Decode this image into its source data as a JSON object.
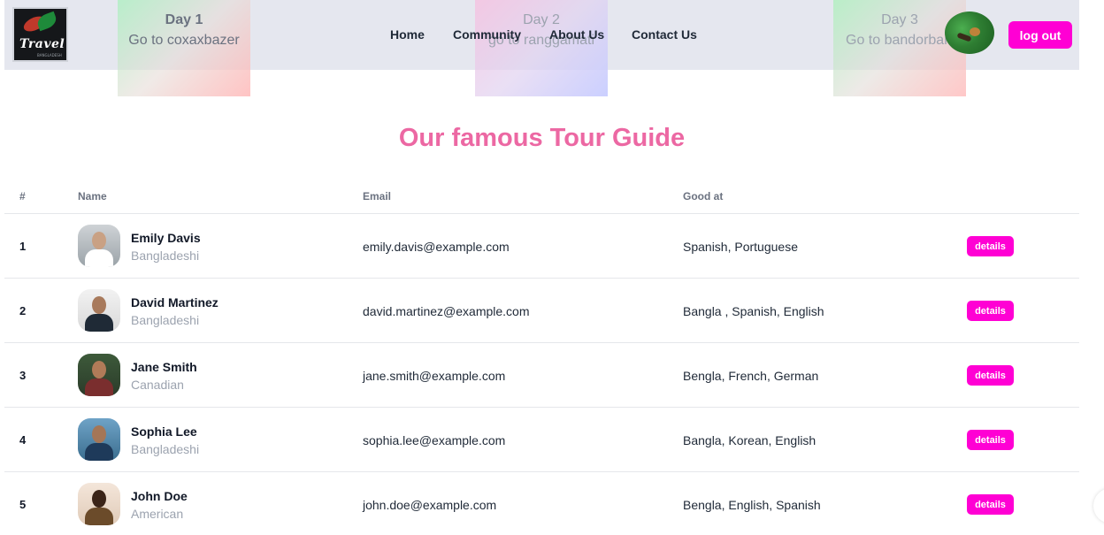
{
  "brand": {
    "logo_text": "Travel",
    "logo_subtext": "BANGLADESH"
  },
  "nav": {
    "links": [
      "Home",
      "Community",
      "About Us",
      "Contact Us"
    ],
    "logout_label": "log out"
  },
  "days": [
    {
      "title": "Day 1",
      "subtitle": "Go to coxaxbazer"
    },
    {
      "title": "Day 2",
      "subtitle": "go to ranggamati"
    },
    {
      "title": "Day 3",
      "subtitle": "Go to bandorban"
    }
  ],
  "section": {
    "title": "Our famous Tour Guide"
  },
  "table": {
    "headers": [
      "#",
      "Name",
      "Email",
      "Good at"
    ],
    "rows": [
      {
        "num": "1",
        "name": "Emily Davis",
        "nationality": "Bangladeshi",
        "email": "emily.davis@example.com",
        "skills": "Spanish, Portuguese",
        "action": "details"
      },
      {
        "num": "2",
        "name": "David Martinez",
        "nationality": "Bangladeshi",
        "email": "david.martinez@example.com",
        "skills": "Bangla , Spanish, English",
        "action": "details"
      },
      {
        "num": "3",
        "name": "Jane Smith",
        "nationality": "Canadian",
        "email": "jane.smith@example.com",
        "skills": "Bengla, French, German",
        "action": "details"
      },
      {
        "num": "4",
        "name": "Sophia Lee",
        "nationality": "Bangladeshi",
        "email": "sophia.lee@example.com",
        "skills": "Bangla, Korean, English",
        "action": "details"
      },
      {
        "num": "5",
        "name": "John Doe",
        "nationality": "American",
        "email": "john.doe@example.com",
        "skills": "Bengla, English, Spanish",
        "action": "details"
      }
    ]
  },
  "colors": {
    "accent": "#ff00d4",
    "title": "#ec68a3",
    "navbar_bg": "#e5e7ef"
  }
}
